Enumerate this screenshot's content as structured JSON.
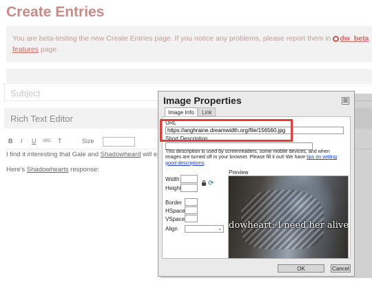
{
  "page": {
    "title": "Create Entries",
    "notice_before": "You are beta-testing the new Create Entries page. If you notice any problems, please report them in",
    "notice_link": "dw_beta",
    "notice_link2": "features",
    "notice_after": "page.",
    "subject_placeholder": "Subject",
    "editor_tab": "Rich Text Editor"
  },
  "toolbar": {
    "items": [
      "B",
      "I",
      "U",
      "ABC",
      "T",
      "Size"
    ]
  },
  "editor": {
    "line1_start": "I find it interesting that Gale and",
    "line1_name": "Shadowheard",
    "line1_end": "will each pro",
    "line2_start": "Here's",
    "line2_name": "Shadowhearts",
    "line2_end": "response:"
  },
  "dialog": {
    "title": "Image Properties",
    "close_glyph": "⊠",
    "tabs": [
      "Image Info",
      "Link"
    ],
    "url_label": "URL",
    "url_value": "https://anghraine.dreamwidth.org/file/156560.jpg",
    "short_desc_label": "Short Description",
    "short_desc_value": "",
    "desc_note": "This description is used by screenreaders, some mobile devices, and when images are turned off in your browser. Please fill it out! We have",
    "desc_link": "tips on writing good descriptions",
    "desc_note_end": ".",
    "width_label": "Width",
    "height_label": "Height",
    "border_label": "Border",
    "hspace_label": "HSpace",
    "vspace_label": "VSpace",
    "align_label": "Align",
    "align_value": "",
    "preview_label": "Preview",
    "preview_caption": "dowheart: I need her alive",
    "ok_label": "OK",
    "cancel_label": "Cancel"
  },
  "colors": {
    "title": "#c98a86",
    "link": "#c96b66",
    "highlight": "#e53b3b"
  }
}
